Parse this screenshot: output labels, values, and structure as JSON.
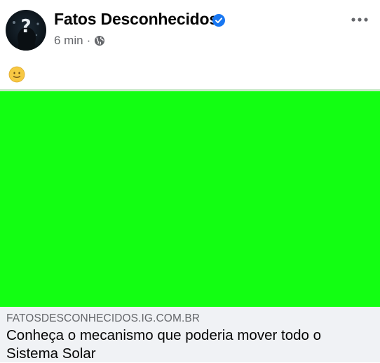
{
  "post": {
    "author": "Fatos Desconhecidos",
    "verified_icon": "verified-badge-icon",
    "time": "6 min",
    "separator": "·",
    "audience_icon": "globe-icon",
    "more_icon": "more-options-icon",
    "text_emoji": "slightly-smiling-face-emoji"
  },
  "link_preview": {
    "domain": "FATOSDESCONHECIDOS.IG.COM.BR",
    "title": "Conheça o mecanismo que poderia mover todo o Sistema Solar"
  },
  "colors": {
    "media_background": "#12ff12",
    "link_background": "#f0f2f5",
    "verified_blue": "#1877f2",
    "secondary_text": "#65676b"
  }
}
